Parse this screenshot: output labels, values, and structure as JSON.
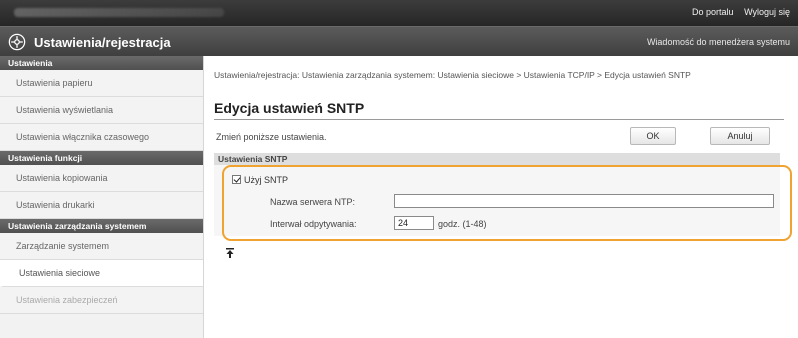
{
  "topbar": {
    "links": [
      "Do portalu",
      "Wyloguj się"
    ]
  },
  "header": {
    "title": "Ustawienia/rejestracja",
    "message_link": "Wiadomość do menedżera systemu"
  },
  "sidebar": {
    "sections": [
      {
        "heading": "Ustawienia",
        "items": [
          "Ustawienia papieru",
          "Ustawienia wyświetlania",
          "Ustawienia włącznika czasowego"
        ]
      },
      {
        "heading": "Ustawienia funkcji",
        "items": [
          "Ustawienia kopiowania",
          "Ustawienia drukarki"
        ]
      },
      {
        "heading": "Ustawienia zarządzania systemem",
        "items": [
          "Zarządzanie systemem",
          "Ustawienia sieciowe",
          "Ustawienia zabezpieczeń"
        ]
      }
    ]
  },
  "breadcrumb": "Ustawienia/rejestracja: Ustawienia zarządzania systemem: Ustawienia sieciowe > Ustawienia TCP/IP > Edycja ustawień SNTP",
  "page": {
    "title": "Edycja ustawień SNTP",
    "instruction": "Zmień poniższe ustawienia.",
    "ok_label": "OK",
    "cancel_label": "Anuluj"
  },
  "section": {
    "heading": "Ustawienia SNTP",
    "use_sntp_label": "Użyj SNTP",
    "use_sntp_checked": true,
    "server_label": "Nazwa serwera NTP:",
    "server_value": "",
    "interval_label": "Interwał odpytywania:",
    "interval_value": "24",
    "interval_unit": "godz. (1-48)"
  },
  "colors": {
    "highlight": "#f0a330",
    "topbar": "#2e2e2e",
    "titlebar": "#4a4a4a"
  },
  "icons": {
    "app": "gear-icon",
    "back_to_top": "back-to-top-icon"
  }
}
